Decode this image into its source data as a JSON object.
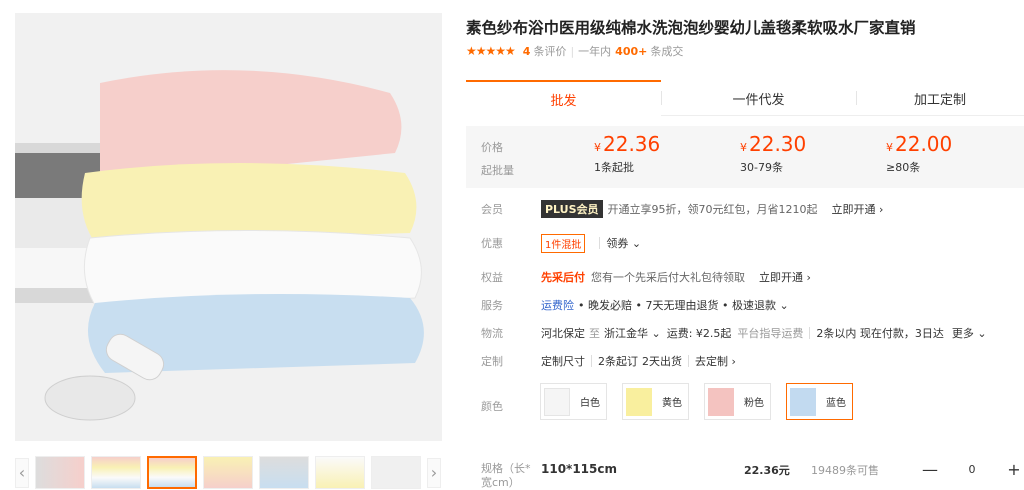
{
  "product": {
    "title": "素色纱布浴巾医用级纯棉水洗泡泡纱婴幼儿盖毯柔软吸水厂家直销",
    "stars": "★★★★★",
    "review_count": "4",
    "review_label": "条评价",
    "year_label": "一年内",
    "sold_count": "400+",
    "sold_label": "条成交"
  },
  "tabs": [
    "批发",
    "一件代发",
    "加工定制"
  ],
  "price_labels": {
    "price": "价格",
    "min": "起批量"
  },
  "tiers": [
    {
      "currency": "¥",
      "price": "22.36",
      "min": "1条起批"
    },
    {
      "currency": "¥",
      "price": "22.30",
      "min": "30-79条"
    },
    {
      "currency": "¥",
      "price": "22.00",
      "min": "≥80条"
    }
  ],
  "member": {
    "label": "会员",
    "badge": "PLUS会员",
    "text": "开通立享95折，领70元红包，月省1210起",
    "link": "立即开通 ›"
  },
  "discount": {
    "label": "优惠",
    "tag": "1件混批",
    "coupon": "领券 ⌄"
  },
  "rights": {
    "label": "权益",
    "highlight": "先采后付",
    "text": "您有一个先采后付大礼包待领取",
    "link": "立即开通 ›"
  },
  "service": {
    "label": "服务",
    "blue": "运费险",
    "text": "• 晚发必赔 • 7天无理由退货 • 极速退款 ⌄"
  },
  "logistics": {
    "label": "物流",
    "from": "河北保定",
    "to_label": "至",
    "to": "浙江金华 ⌄",
    "fee": "运费: ¥2.5起",
    "platform": "平台指导运费",
    "delivery": "2条以内 现在付款，3日达",
    "more": "更多 ⌄"
  },
  "custom": {
    "label": "定制",
    "item1": "定制尺寸",
    "item2": "2条起订",
    "item3": "2天出货",
    "link": "去定制 ›"
  },
  "colors": {
    "label": "颜色",
    "options": [
      "白色",
      "黄色",
      "粉色",
      "蓝色"
    ],
    "selected": "蓝色"
  },
  "spec": {
    "label": "规格（长*宽cm）",
    "size": "110*115cm",
    "price": "22.36元",
    "stock": "19489条可售",
    "qty": "0",
    "minus": "—",
    "plus": "+"
  },
  "accent": "#ff6a00",
  "price_color": "#ff4000"
}
